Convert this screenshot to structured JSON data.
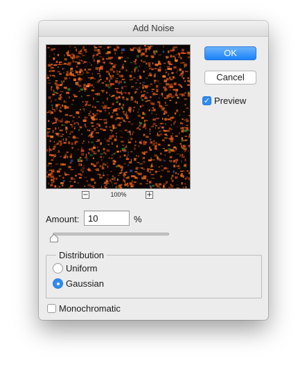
{
  "dialog": {
    "title": "Add Noise"
  },
  "preview": {
    "zoom_out_symbol": "−",
    "zoom_in_symbol": "+",
    "zoom_level": "100%",
    "background": "#0a0502",
    "noise_colors": [
      "#e5611c",
      "#c4471a",
      "#f07a2a",
      "#8a3212",
      "#2f7a2a",
      "#2a4f9a"
    ]
  },
  "buttons": {
    "ok_label": "OK",
    "cancel_label": "Cancel"
  },
  "preview_checkbox": {
    "label": "Preview",
    "checked": true
  },
  "amount": {
    "label": "Amount:",
    "value": "10",
    "unit": "%",
    "slider_fraction": 0.025
  },
  "distribution": {
    "title": "Distribution",
    "options": [
      {
        "label": "Uniform",
        "selected": false
      },
      {
        "label": "Gaussian",
        "selected": true
      }
    ]
  },
  "monochromatic": {
    "label": "Monochromatic",
    "checked": false
  },
  "colors": {
    "accent": "#2d8cf0",
    "ok_button": "#1a82fb"
  }
}
